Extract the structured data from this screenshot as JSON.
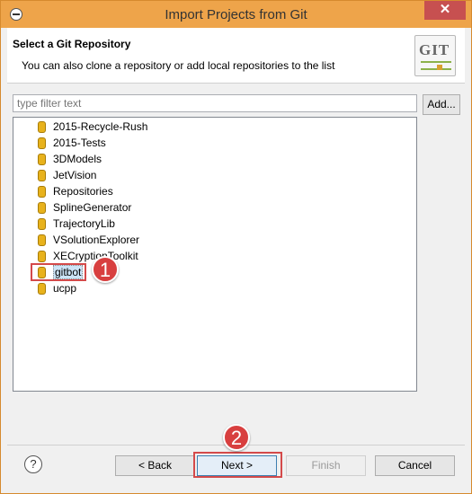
{
  "window": {
    "title": "Import Projects from Git",
    "close_glyph": "✕"
  },
  "header": {
    "title": "Select a Git Repository",
    "subtitle": "You can also clone a repository or add local repositories to the list",
    "logo_text": "GIT"
  },
  "filter": {
    "placeholder": "type filter text"
  },
  "add_button": "Add...",
  "repositories": [
    {
      "name": "2015-Recycle-Rush"
    },
    {
      "name": "2015-Tests"
    },
    {
      "name": "3DModels"
    },
    {
      "name": "JetVision"
    },
    {
      "name": "Repositories"
    },
    {
      "name": "SplineGenerator"
    },
    {
      "name": "TrajectoryLib"
    },
    {
      "name": "VSolutionExplorer"
    },
    {
      "name": "XECryptionToolkit"
    },
    {
      "name": "gitbot",
      "selected": true
    },
    {
      "name": "ucpp"
    }
  ],
  "annotations": {
    "step1": "1",
    "step2": "2"
  },
  "buttons": {
    "help": "?",
    "back": "< Back",
    "next": "Next >",
    "finish": "Finish",
    "cancel": "Cancel"
  },
  "colors": {
    "accent": "#d83f3f",
    "titlebar": "#eea44a",
    "repo_icon": "#e8b21c"
  }
}
